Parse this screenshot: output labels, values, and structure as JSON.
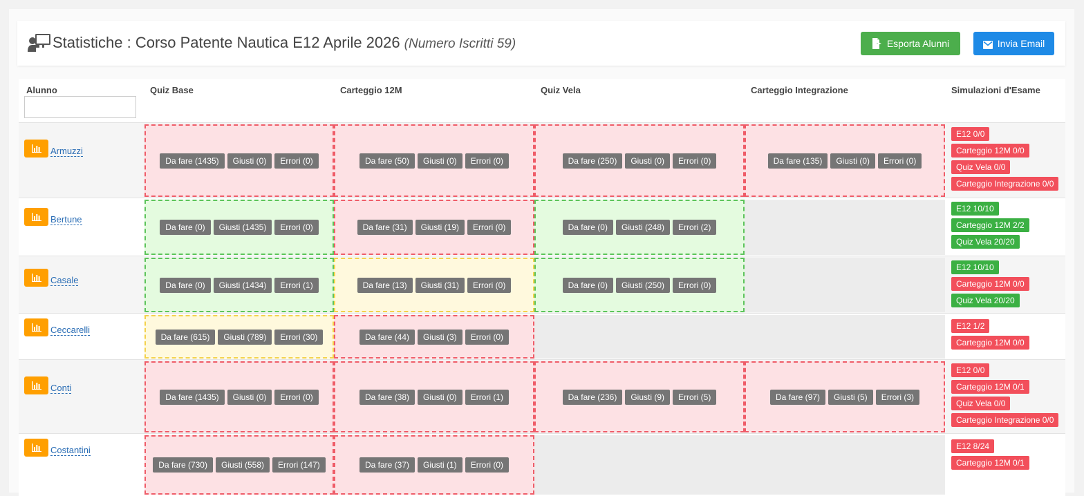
{
  "header": {
    "title": "Statistiche : Corso Patente Nautica E12 Aprile 2026",
    "subtitle": "(Numero Iscritti 59)",
    "export_label": "Esporta Alunni",
    "email_label": "Invia Email"
  },
  "table": {
    "columns": [
      "Alunno",
      "Quiz Base",
      "Carteggio 12M",
      "Quiz Vela",
      "Carteggio Integrazione",
      "Simulazioni d'Esame"
    ],
    "filter_value": ""
  },
  "colors": {
    "red_cell": "#fde1e4",
    "green_cell": "#e4fbdf",
    "yellow_cell": "#fff9dd",
    "badge_red": "#f24f5b",
    "badge_green": "#3bb043",
    "stat_button": "#ff9f00"
  },
  "rows": [
    {
      "name": "Armuzzi",
      "cells": [
        {
          "status": "red",
          "tags": [
            "Da fare (1435)",
            "Giusti (0)",
            "Errori (0)"
          ]
        },
        {
          "status": "red",
          "tags": [
            "Da fare (50)",
            "Giusti (0)",
            "Errori (0)"
          ]
        },
        {
          "status": "red",
          "tags": [
            "Da fare (250)",
            "Giusti (0)",
            "Errori (0)"
          ]
        },
        {
          "status": "red",
          "tags": [
            "Da fare (135)",
            "Giusti (0)",
            "Errori (0)"
          ]
        }
      ],
      "sims": [
        {
          "label": "E12 0/0",
          "status": "red"
        },
        {
          "label": "Carteggio 12M 0/0",
          "status": "red"
        },
        {
          "label": "Quiz Vela 0/0",
          "status": "red"
        },
        {
          "label": "Carteggio Integrazione 0/0",
          "status": "red"
        }
      ]
    },
    {
      "name": "Bertune",
      "cells": [
        {
          "status": "green",
          "tags": [
            "Da fare (0)",
            "Giusti (1435)",
            "Errori (0)"
          ]
        },
        {
          "status": "red",
          "tags": [
            "Da fare (31)",
            "Giusti (19)",
            "Errori (0)"
          ]
        },
        {
          "status": "green",
          "tags": [
            "Da fare (0)",
            "Giusti (248)",
            "Errori (2)"
          ]
        },
        {
          "status": "empty",
          "tags": []
        }
      ],
      "sims": [
        {
          "label": "E12 10/10",
          "status": "green"
        },
        {
          "label": "Carteggio 12M 2/2",
          "status": "green"
        },
        {
          "label": "Quiz Vela 20/20",
          "status": "green"
        }
      ]
    },
    {
      "name": "Casale",
      "cells": [
        {
          "status": "green",
          "tags": [
            "Da fare (0)",
            "Giusti (1434)",
            "Errori (1)"
          ]
        },
        {
          "status": "yellow",
          "tags": [
            "Da fare (13)",
            "Giusti (31)",
            "Errori (0)"
          ]
        },
        {
          "status": "green",
          "tags": [
            "Da fare (0)",
            "Giusti (250)",
            "Errori (0)"
          ]
        },
        {
          "status": "empty",
          "tags": []
        }
      ],
      "sims": [
        {
          "label": "E12 10/10",
          "status": "green"
        },
        {
          "label": "Carteggio 12M 0/0",
          "status": "red"
        },
        {
          "label": "Quiz Vela 20/20",
          "status": "green"
        }
      ]
    },
    {
      "name": "Ceccarelli",
      "cells": [
        {
          "status": "yellow",
          "tags": [
            "Da fare (615)",
            "Giusti (789)",
            "Errori (30)"
          ]
        },
        {
          "status": "red",
          "tags": [
            "Da fare (44)",
            "Giusti (3)",
            "Errori (0)"
          ]
        },
        {
          "status": "empty",
          "tags": []
        },
        {
          "status": "empty",
          "tags": []
        }
      ],
      "sims": [
        {
          "label": "E12 1/2",
          "status": "red"
        },
        {
          "label": "Carteggio 12M 0/0",
          "status": "red"
        }
      ]
    },
    {
      "name": "Conti",
      "cells": [
        {
          "status": "red",
          "tags": [
            "Da fare (1435)",
            "Giusti (0)",
            "Errori (0)"
          ]
        },
        {
          "status": "red",
          "tags": [
            "Da fare (38)",
            "Giusti (0)",
            "Errori (1)"
          ]
        },
        {
          "status": "red",
          "tags": [
            "Da fare (236)",
            "Giusti (9)",
            "Errori (5)"
          ]
        },
        {
          "status": "red",
          "tags": [
            "Da fare (97)",
            "Giusti (5)",
            "Errori (3)"
          ]
        }
      ],
      "sims": [
        {
          "label": "E12 0/0",
          "status": "red"
        },
        {
          "label": "Carteggio 12M 0/1",
          "status": "red"
        },
        {
          "label": "Quiz Vela 0/0",
          "status": "red"
        },
        {
          "label": "Carteggio Integrazione 0/0",
          "status": "red"
        }
      ]
    },
    {
      "name": "Costantini",
      "cells": [
        {
          "status": "red",
          "tags": [
            "Da fare (730)",
            "Giusti (558)",
            "Errori (147)"
          ]
        },
        {
          "status": "red",
          "tags": [
            "Da fare (37)",
            "Giusti (1)",
            "Errori (0)"
          ]
        },
        {
          "status": "empty",
          "tags": []
        },
        {
          "status": "empty",
          "tags": []
        }
      ],
      "sims": [
        {
          "label": "E12 8/24",
          "status": "red"
        },
        {
          "label": "Carteggio 12M 0/1",
          "status": "red"
        }
      ]
    }
  ]
}
